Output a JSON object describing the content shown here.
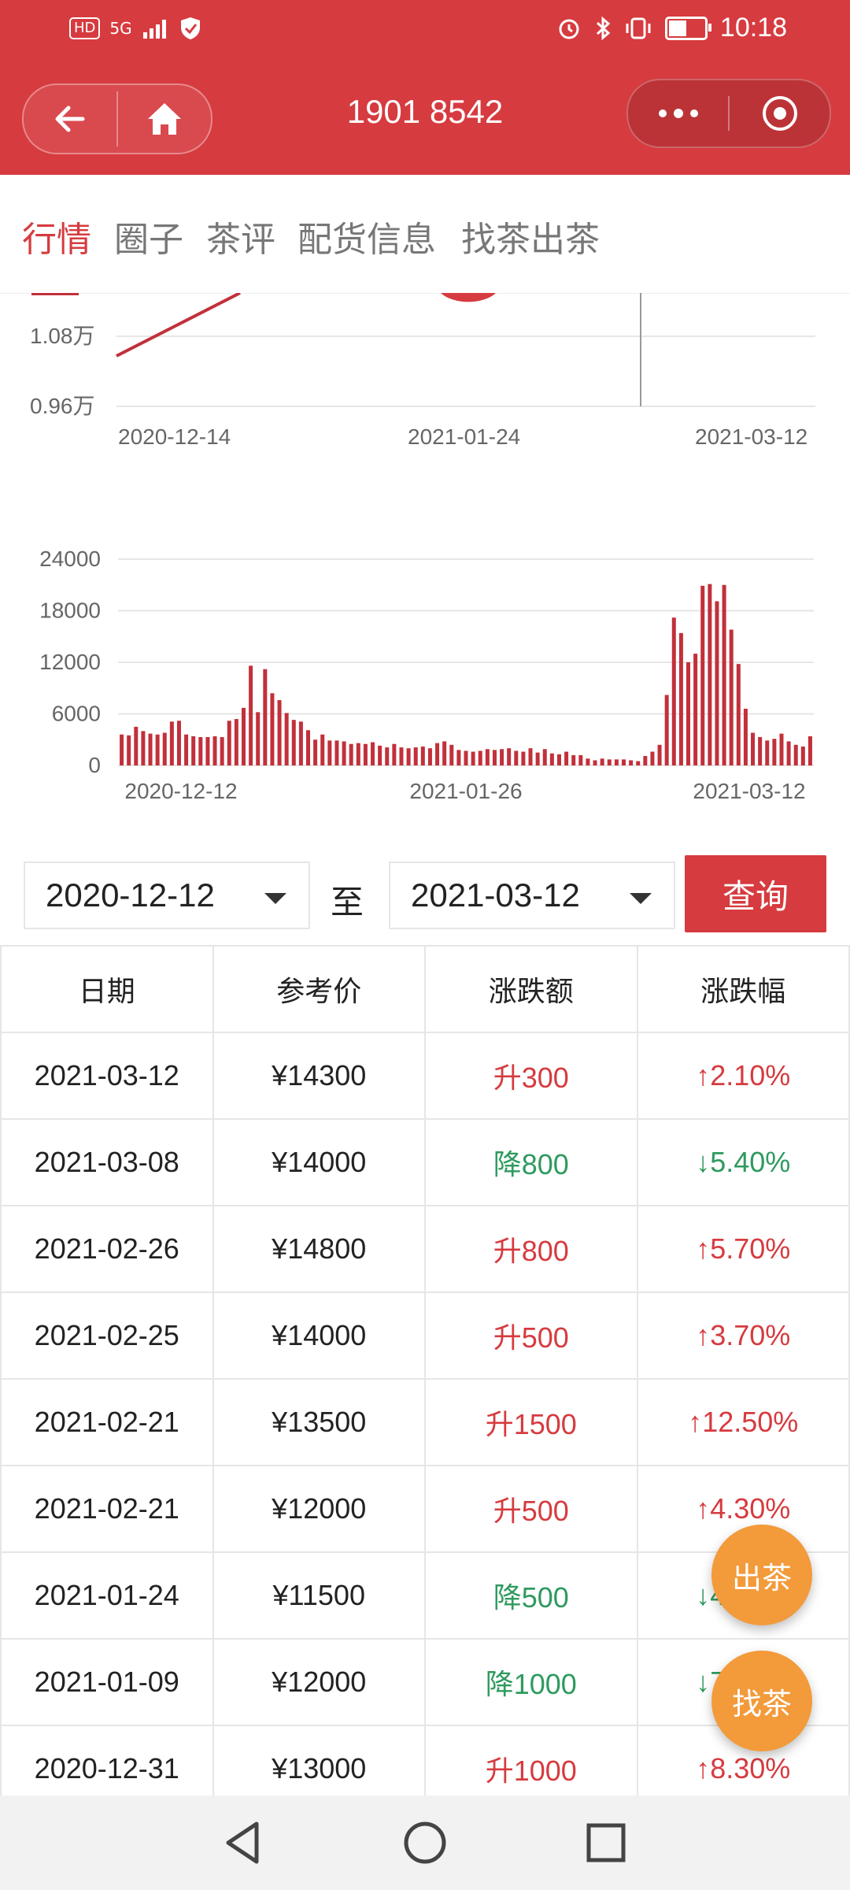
{
  "status": {
    "time": "10:18",
    "left_badges": [
      "HD",
      "5G"
    ],
    "icons": [
      "signal-icon",
      "shield-icon",
      "alarm-icon",
      "bluetooth-icon",
      "vibrate-icon",
      "battery-icon"
    ]
  },
  "header": {
    "title": "1901 8542"
  },
  "tabs": [
    {
      "label": "行情",
      "active": true
    },
    {
      "label": "圈子",
      "active": false
    },
    {
      "label": "茶评",
      "active": false
    },
    {
      "label": "配货信息",
      "active": false
    },
    {
      "label": "找茶出茶",
      "active": false
    }
  ],
  "colors": {
    "brand_red": "#d63b3f",
    "green": "#2f9a5f",
    "fab_orange": "#f39a3a"
  },
  "chart_data": [
    {
      "type": "line",
      "ytick_labels": [
        "1.08万",
        "0.96万"
      ],
      "x_tick_labels": [
        "2020-12-14",
        "2021-01-24",
        "2021-03-12"
      ]
    },
    {
      "type": "bar",
      "ylim": [
        0,
        24000
      ],
      "ytick_labels": [
        "24000",
        "18000",
        "12000",
        "6000",
        "0"
      ],
      "x_tick_labels": [
        "2020-12-12",
        "2021-01-26",
        "2021-03-12"
      ],
      "values": [
        3600,
        3500,
        4500,
        4000,
        3700,
        3600,
        3800,
        5100,
        5200,
        3600,
        3400,
        3300,
        3300,
        3400,
        3300,
        5200,
        5400,
        6700,
        11600,
        6200,
        11200,
        8400,
        7600,
        6100,
        5300,
        5100,
        4100,
        3000,
        3600,
        2900,
        2900,
        2800,
        2500,
        2600,
        2500,
        2700,
        2300,
        2100,
        2500,
        2100,
        2000,
        2100,
        2200,
        2000,
        2600,
        2800,
        2400,
        1800,
        1700,
        1600,
        1700,
        1900,
        1800,
        1900,
        2000,
        1700,
        1600,
        2000,
        1500,
        1900,
        1400,
        1300,
        1600,
        1200,
        1200,
        800,
        600,
        800,
        700,
        700,
        700,
        600,
        500,
        1100,
        1600,
        2400,
        8200,
        17200,
        15400,
        12000,
        13000,
        20900,
        21100,
        19100,
        21000,
        15800,
        11800,
        6600,
        3800,
        3300,
        2900,
        3100,
        3700,
        2800,
        2400,
        2200,
        3400
      ]
    }
  ],
  "query": {
    "start_date": "2020-12-12",
    "to_label": "至",
    "end_date": "2021-03-12",
    "button": "查询"
  },
  "table": {
    "headers": [
      "日期",
      "参考价",
      "涨跌额",
      "涨跌幅"
    ],
    "rows": [
      {
        "date": "2021-03-12",
        "price": "¥14300",
        "change": "升300",
        "pct": "↑2.10%",
        "dir": "up"
      },
      {
        "date": "2021-03-08",
        "price": "¥14000",
        "change": "降800",
        "pct": "↓5.40%",
        "dir": "down"
      },
      {
        "date": "2021-02-26",
        "price": "¥14800",
        "change": "升800",
        "pct": "↑5.70%",
        "dir": "up"
      },
      {
        "date": "2021-02-25",
        "price": "¥14000",
        "change": "升500",
        "pct": "↑3.70%",
        "dir": "up"
      },
      {
        "date": "2021-02-21",
        "price": "¥13500",
        "change": "升1500",
        "pct": "↑12.50%",
        "dir": "up"
      },
      {
        "date": "2021-02-21",
        "price": "¥12000",
        "change": "升500",
        "pct": "↑4.30%",
        "dir": "up"
      },
      {
        "date": "2021-01-24",
        "price": "¥11500",
        "change": "降500",
        "pct": "↓4.20%",
        "dir": "down"
      },
      {
        "date": "2021-01-09",
        "price": "¥12000",
        "change": "降1000",
        "pct": "↓7.70%",
        "dir": "down"
      },
      {
        "date": "2020-12-31",
        "price": "¥13000",
        "change": "升1000",
        "pct": "↑8.30%",
        "dir": "up"
      }
    ]
  },
  "fab": {
    "sell": "出茶",
    "find": "找茶"
  }
}
